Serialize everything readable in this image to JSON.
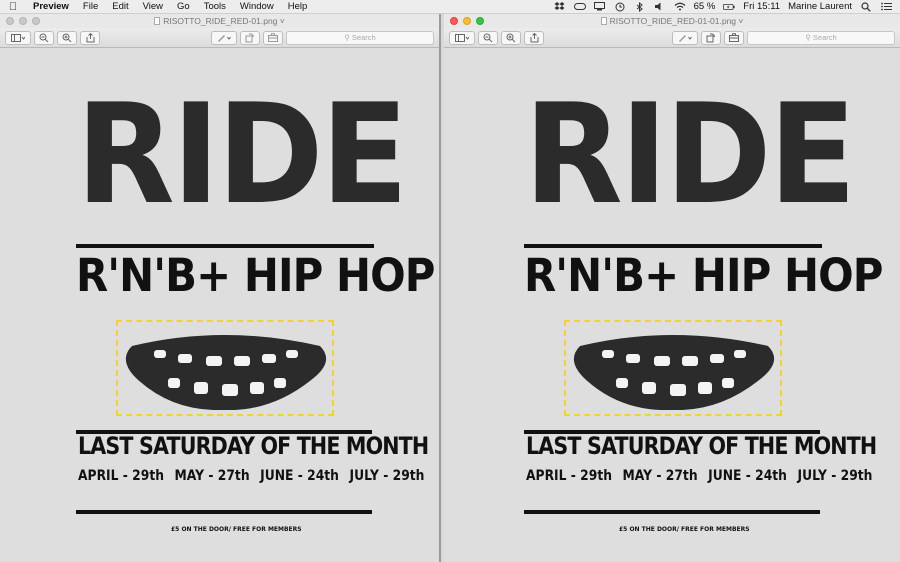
{
  "menubar": {
    "app": "Preview",
    "items": [
      "File",
      "Edit",
      "View",
      "Go",
      "Tools",
      "Window",
      "Help"
    ],
    "battery": "65 %",
    "clock": "Fri 15:11",
    "user": "Marine Laurent"
  },
  "windows": {
    "left": {
      "title": "RISOTTO_RIDE_RED-01.png"
    },
    "right": {
      "title": "RISOTTO_RIDE_RED-01-01.png"
    }
  },
  "toolbar": {
    "search_placeholder": "Search"
  },
  "poster": {
    "title": "RIDE",
    "subtitle": "R'N'B+ HIP HOP",
    "headline": "LAST SATURDAY OF THE MONTH",
    "dates": [
      "APRIL - 29th",
      "MAY - 27th",
      "JUNE - 24th",
      "JULY - 29th"
    ],
    "footer": "£5 ON THE DOOR/ FREE FOR MEMBERS"
  },
  "colors": {
    "highlight_dash": "#f2d42c",
    "ink": "#111111",
    "paper": "#dedede"
  }
}
